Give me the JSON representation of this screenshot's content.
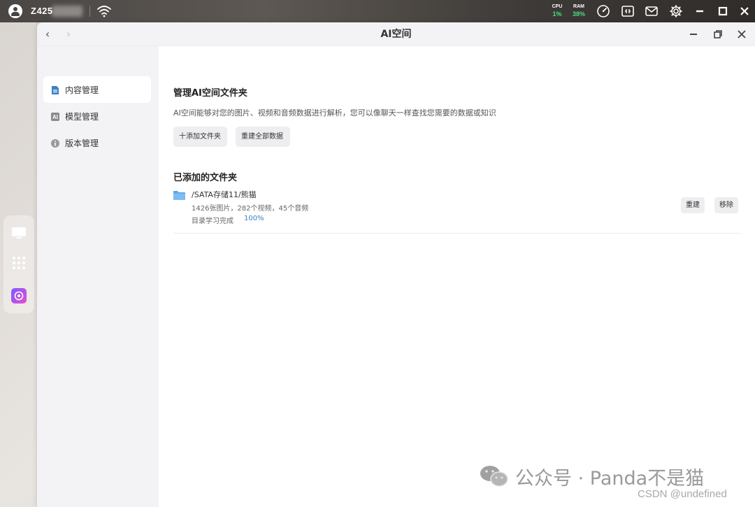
{
  "system_bar": {
    "device_name": "Z425",
    "cpu_label": "CPU",
    "cpu_value": "1%",
    "ram_label": "RAM",
    "ram_value": "38%",
    "stat_color": "#4ade80"
  },
  "dock": {
    "items": [
      "monitor-icon",
      "apps-grid-icon",
      "ai-space-app-icon"
    ]
  },
  "window": {
    "title": "AI空间",
    "nav_back": "‹",
    "nav_forward": "›"
  },
  "sidebar": {
    "items": [
      {
        "label": "内容管理",
        "icon": "document-icon",
        "active": true
      },
      {
        "label": "模型管理",
        "icon": "ai-model-icon",
        "active": false
      },
      {
        "label": "版本管理",
        "icon": "info-icon",
        "active": false
      }
    ]
  },
  "main": {
    "manage_title": "管理AI空间文件夹",
    "manage_desc": "AI空间能够对您的图片、视频和音频数据进行解析，您可以像聊天一样查找您需要的数据或知识",
    "add_folder_label": "十添加文件夹",
    "rebuild_all_label": "重建全部数据",
    "added_title": "已添加的文件夹",
    "folders": [
      {
        "path": "/SATA存储11/熊猫",
        "stats": "1426张图片，282个视频，45个音频",
        "status": "目录学习完成",
        "progress": "100%",
        "rebuild_label": "重建",
        "remove_label": "移除"
      }
    ],
    "accent_color": "#3b82c4"
  },
  "watermark": {
    "wechat_text": "公众号 · Panda不是猫",
    "csdn_text": "CSDN @undefined"
  }
}
